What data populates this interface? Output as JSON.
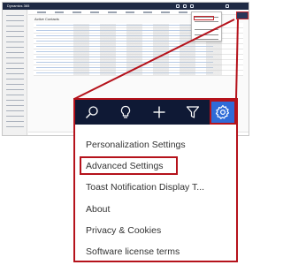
{
  "background": {
    "app_title": "Dynamics 365",
    "view_title": "Active Contacts"
  },
  "toolbar": {
    "icons": [
      "search-icon",
      "lightbulb-icon",
      "plus-icon",
      "filter-icon",
      "gear-icon"
    ],
    "accent": "#2f6bd8",
    "bar_color": "#0f1935"
  },
  "settings_menu": {
    "items": [
      {
        "label": "Personalization Settings"
      },
      {
        "label": "Advanced Settings",
        "highlighted": true
      },
      {
        "label": "Toast Notification Display T..."
      },
      {
        "label": "About"
      },
      {
        "label": "Privacy & Cookies"
      },
      {
        "label": "Software license terms"
      }
    ],
    "highlight_color": "#b5121b"
  }
}
